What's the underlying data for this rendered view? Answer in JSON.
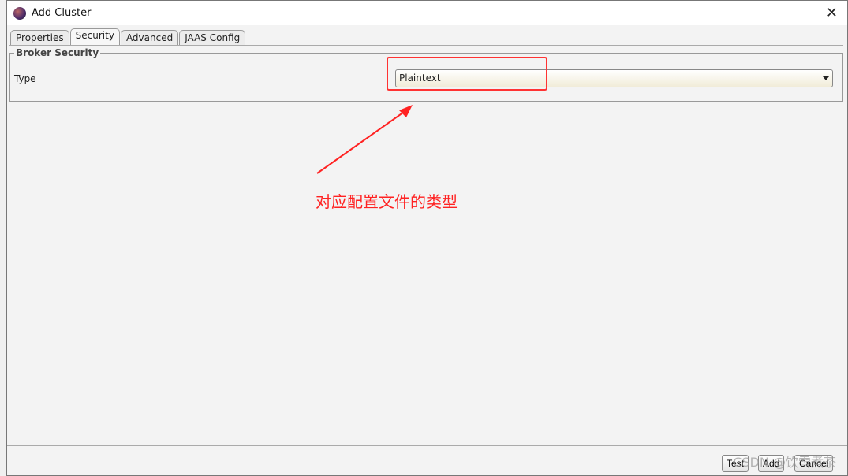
{
  "window": {
    "title": "Add Cluster"
  },
  "tabs": [
    {
      "label": "Properties"
    },
    {
      "label": "Security"
    },
    {
      "label": "Advanced"
    },
    {
      "label": "JAAS Config"
    }
  ],
  "security": {
    "group_title": "Broker Security",
    "type_label": "Type",
    "type_value": "Plaintext"
  },
  "annotation": {
    "text": "对应配置文件的类型",
    "color": "#ff2222"
  },
  "buttons": {
    "test": "Test",
    "add": "Add",
    "cancel": "Cancel"
  },
  "watermark": "CSDN @饮雪煮茶"
}
